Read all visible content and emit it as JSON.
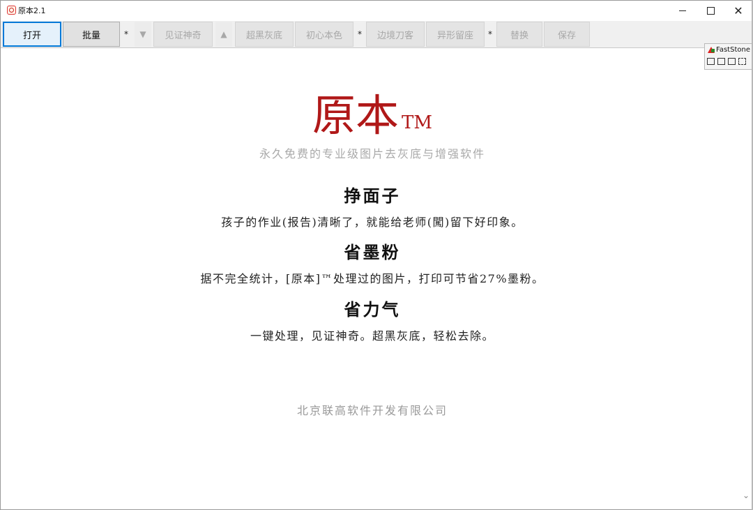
{
  "window": {
    "title": "原本2.1"
  },
  "toolbar": {
    "open": "打开",
    "batch": "批量",
    "sep1": "*",
    "down_arrow": "▼",
    "see_miracle": "见证神奇",
    "up_arrow": "▲",
    "super_black": "超黑灰底",
    "original_color": "初心本色",
    "sep2": "*",
    "border_blade": "边境刀客",
    "odd_shape": "异形留座",
    "sep3": "*",
    "replace": "替换",
    "save": "保存"
  },
  "main": {
    "logo": "原本",
    "tm": "TM",
    "slogan": "永久免费的专业级图片去灰底与增强软件",
    "sections": [
      {
        "heading": "挣面子",
        "desc": "孩子的作业(报告)清晰了，就能给老师(闖)留下好印象。"
      },
      {
        "heading": "省墨粉",
        "desc": "据不完全统计，[原本]™处理过的图片，打印可节省27%墨粉。"
      },
      {
        "heading": "省力气",
        "desc": "一键处理，见证神奇。超黑灰底，轻松去除。"
      }
    ],
    "company": "北京联高软件开发有限公司"
  },
  "overlay": {
    "title": "FastStone C"
  },
  "icons": [
    "app-logo-icon",
    "minimize-icon",
    "maximize-icon",
    "close-icon",
    "faststone-logo-icon",
    "open-folder-icon",
    "window-icon",
    "window-restore-icon",
    "region-select-icon",
    "scroll-down-icon"
  ]
}
